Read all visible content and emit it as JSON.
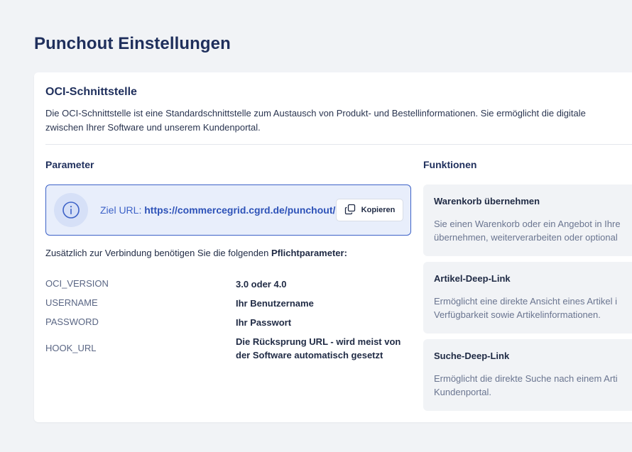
{
  "page": {
    "title": "Punchout Einstellungen"
  },
  "card": {
    "title": "OCI-Schnittstelle",
    "description_line1": "Die OCI-Schnittstelle ist eine Standardschnittstelle zum Austausch von  Produkt- und Bestellinformationen. Sie ermöglicht die digitale",
    "description_line2": "zwischen Ihrer Software und unserem  Kundenportal."
  },
  "parameter": {
    "heading": "Parameter",
    "url_label": "Ziel URL: ",
    "url_value": "https://commercegrid.cgrd.de/punchout/",
    "copy_label": "Kopieren",
    "required_prefix": "Zusätzlich zur Verbindung benötigen Sie die folgenden ",
    "required_bold": "Pflichtparameter:",
    "rows": [
      {
        "key": "OCI_VERSION",
        "value_line1": "3.0 oder 4.0",
        "value_line2": ""
      },
      {
        "key": "USERNAME",
        "value_line1": "Ihr Benutzername",
        "value_line2": ""
      },
      {
        "key": "PASSWORD",
        "value_line1": "Ihr Passwort",
        "value_line2": ""
      },
      {
        "key": "HOOK_URL",
        "value_line1": "Die Rücksprung URL - wird meist von",
        "value_line2": "der Software automatisch gesetzt"
      }
    ]
  },
  "funktionen": {
    "heading": "Funktionen",
    "items": [
      {
        "title": "Warenkorb übernehmen",
        "desc_line1": "Sie einen Warenkorb oder ein Angebot in Ihre",
        "desc_line2": "übernehmen, weiterverarbeiten oder optional"
      },
      {
        "title": "Artikel-Deep-Link",
        "desc_line1": "Ermöglicht eine direkte Ansicht eines Artikel i",
        "desc_line2": "Verfügbarkeit sowie Artikelinformationen."
      },
      {
        "title": "Suche-Deep-Link",
        "desc_line1": "Ermöglicht die direkte Suche nach einem Arti",
        "desc_line2": "Kundenportal."
      }
    ]
  },
  "icons": {
    "info": "info-icon",
    "copy": "copy-icon"
  },
  "colors": {
    "accent": "#3d62c7",
    "title": "#1f2f5c",
    "background": "#f1f3f6"
  }
}
